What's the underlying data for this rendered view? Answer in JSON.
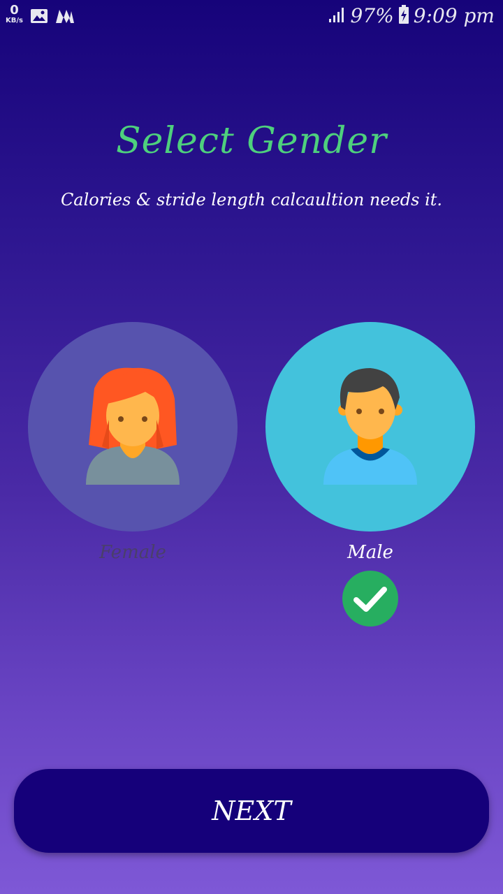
{
  "status_bar": {
    "speed_value": "0",
    "speed_unit": "KB/s",
    "battery_percent": "97%",
    "time": "9:09 pm",
    "icons": [
      "gallery-icon",
      "app-m-icon",
      "signal-icon",
      "battery-charging-icon"
    ]
  },
  "header": {
    "title": "Select Gender",
    "subtitle": "Calories & stride length calcaultion needs it."
  },
  "options": {
    "female_label": "Female",
    "male_label": "Male",
    "selected": "Male"
  },
  "footer": {
    "next_label": "NEXT"
  },
  "colors": {
    "title": "#4ed07d",
    "button": "#15007a",
    "male_bg": "#43c2dc",
    "female_bg": "#5753ae",
    "check": "#27ae60"
  }
}
